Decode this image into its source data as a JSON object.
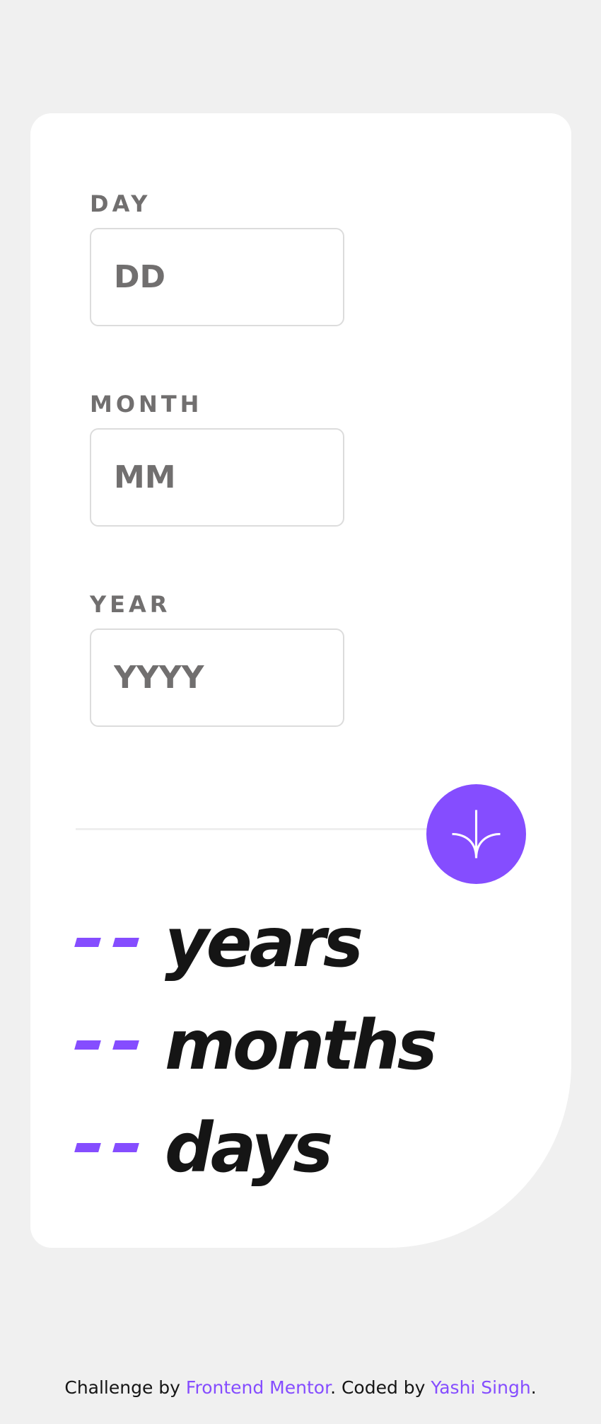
{
  "form": {
    "day": {
      "label": "DAY",
      "placeholder": "DD"
    },
    "month": {
      "label": "MONTH",
      "placeholder": "MM"
    },
    "year": {
      "label": "YEAR",
      "placeholder": "YYYY"
    },
    "submit_icon": "arrow-down-icon"
  },
  "results": {
    "years": {
      "value": "--",
      "unit": "years"
    },
    "months": {
      "value": "--",
      "unit": "months"
    },
    "days": {
      "value": "--",
      "unit": "days"
    }
  },
  "footer": {
    "prefix": "Challenge by ",
    "link1": "Frontend Mentor",
    "middle": ". Coded by ",
    "link2": "Yashi Singh",
    "suffix": "."
  },
  "colors": {
    "accent": "#854dff",
    "background": "#f0f0f0",
    "card": "#ffffff",
    "label": "#716f6f",
    "text": "#151515"
  }
}
